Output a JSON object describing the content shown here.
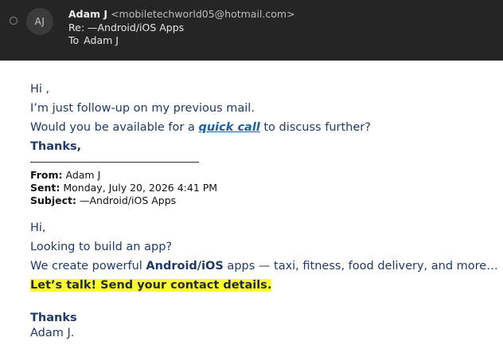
{
  "header": {
    "avatar_initials": "AJ",
    "sender_name": "Adam J",
    "sender_email": "<mobiletechworld05@hotmail.com>",
    "subject": "Re: —Android/iOS Apps",
    "to_label": "To",
    "to_name": "Adam J"
  },
  "reply": {
    "greeting": "Hi ,",
    "line1": "I’m just follow-up on my previous mail.",
    "line2_pre": "Would you be available for a ",
    "line2_link": "quick call",
    "line2_post": " to discuss further?",
    "signoff": "Thanks,"
  },
  "quoted_meta": {
    "from_label": "From:",
    "from_value": "Adam J",
    "sent_label": "Sent:",
    "sent_value": "Monday, July 20, 2026 4:41 PM",
    "subject_label": "Subject:",
    "subject_value": "—Android/iOS Apps"
  },
  "original": {
    "greeting": "Hi,",
    "line1": "Looking to build an app?",
    "line2_pre": "We create powerful ",
    "line2_bold": "Android/iOS",
    "line2_post": " apps — taxi, fitness, food delivery, and more…",
    "cta": "Let’s talk! Send your contact details.",
    "thanks": "Thanks",
    "name": "Adam J."
  }
}
